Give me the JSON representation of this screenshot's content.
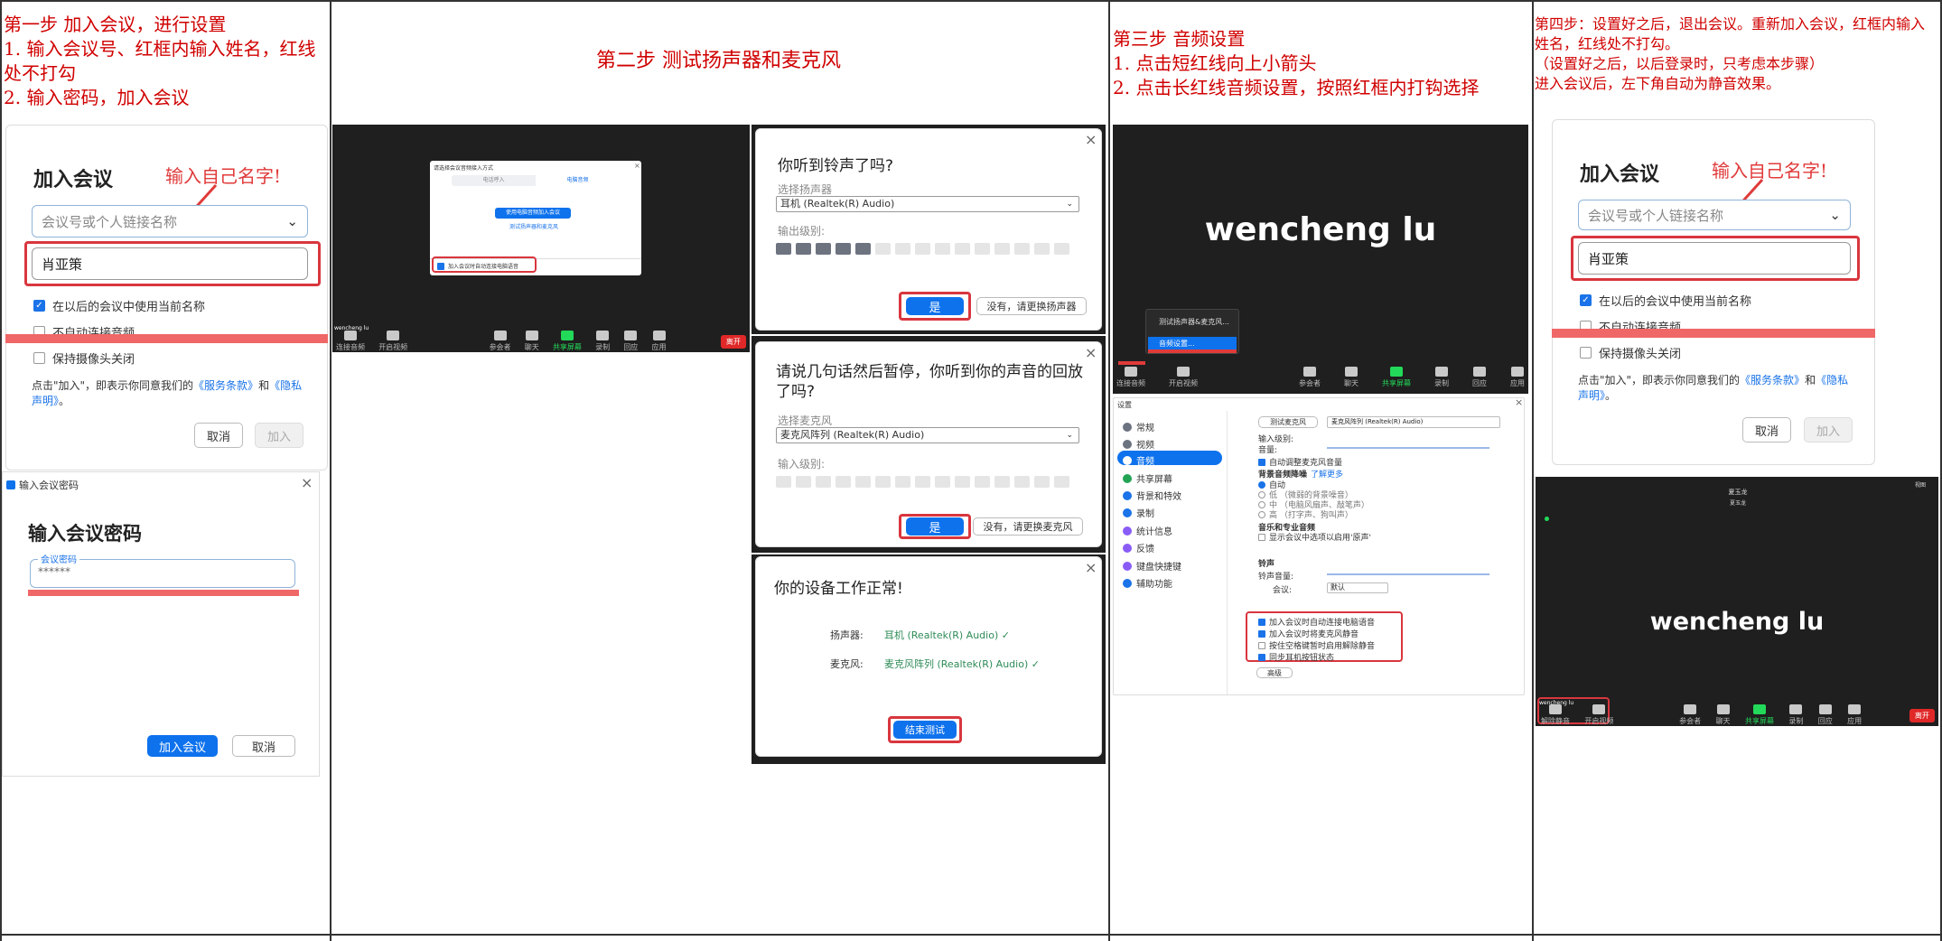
{
  "step1": {
    "title": "第一步  加入会议，进行设置",
    "line1": "1. 输入会议号、红框内输入姓名，红线处不打勾",
    "line2": "2. 输入密码，加入会议"
  },
  "step2": {
    "title": "第二步  测试扬声器和麦克风"
  },
  "step3": {
    "title": "第三步  音频设置",
    "line1": "1. 点击短红线向上小箭头",
    "line2": "2. 点击长红线音频设置，按照红框内打钩选择"
  },
  "step4": {
    "line1": "第四步：设置好之后，退出会议。重新加入会议，红框内输入姓名，红线处不打勾。",
    "line2": "（设置好之后，以后登录时，只考虑本步骤）",
    "line3": "进入会议后，左下角自动为静音效果。"
  },
  "join_dialog": {
    "title": "加入会议",
    "annotation": "输入自己名字!",
    "meeting_placeholder": "会议号或个人链接名称",
    "name_value": "肖亚策",
    "opt_remember": "在以后的会议中使用当前名称",
    "opt_no_audio": "不自动连接音频",
    "opt_camera_off": "保持摄像头关闭",
    "terms_prefix": "点击\"加入\"，即表示你同意我们的",
    "terms_link": "《服务条款》",
    "terms_and": "和",
    "privacy_link": "《隐私声明》",
    "terms_suffix": "。",
    "cancel": "取消",
    "join": "加入"
  },
  "password_dialog": {
    "window_title": "输入会议密码",
    "heading": "输入会议密码",
    "field_label": "会议密码",
    "field_value": "******",
    "join": "加入会议",
    "cancel": "取消"
  },
  "audio_popup": {
    "title": "请选择会议音频接入方式",
    "tab_phone": "电话呼入",
    "tab_computer": "电脑音频",
    "join_btn": "使用电脑音频加入会议",
    "test_link": "测试扬声器和麦克风",
    "auto_join": "加入会议时自动连接电脑语音"
  },
  "meeting_toolbar": {
    "user_label": "wencheng lu",
    "items": [
      "连接音频",
      "开启视频",
      "参会者",
      "聊天",
      "共享屏幕",
      "录制",
      "回应",
      "应用"
    ],
    "end": "离开"
  },
  "speaker_test": {
    "question": "你听到铃声了吗?",
    "select_label": "选择扬声器",
    "device": "耳机 (Realtek(R) Audio)",
    "level_label": "输出级别:",
    "level": 0.3,
    "yes": "是",
    "no": "没有，请更换扬声器"
  },
  "mic_test": {
    "question": "请说几句话然后暂停，你听到你的声音的回放了吗?",
    "select_label": "选择麦克风",
    "device": "麦克风阵列 (Realtek(R) Audio)",
    "level_label": "输入级别:",
    "level": 0,
    "yes": "是",
    "no": "没有，请更换麦克风"
  },
  "device_ok": {
    "title": "你的设备工作正常!",
    "speaker_label": "扬声器:",
    "speaker_value": "耳机 (Realtek(R) Audio) ✓",
    "mic_label": "麦克风:",
    "mic_value": "麦克风阵列 (Realtek(R) Audio) ✓",
    "finish": "结束测试"
  },
  "step3_meeting": {
    "name": "wencheng lu",
    "menu_item1": "测试扬声器&麦克风...",
    "menu_item2": "音频设置...",
    "toolbar": [
      "连接音频",
      "开启视频",
      "参会者",
      "聊天",
      "共享屏幕",
      "录制",
      "回应",
      "应用"
    ]
  },
  "settings": {
    "window_title": "设置",
    "nav": [
      "常规",
      "视频",
      "音频",
      "共享屏幕",
      "背景和特效",
      "录制",
      "统计信息",
      "反馈",
      "键盘快捷键",
      "辅助功能"
    ],
    "active_nav": "音频",
    "test_mic": "测试麦克风",
    "mic_device": "麦克风阵列 (Realtek(R) Audio)",
    "input_level": "输入级别:",
    "volume": "音量:",
    "auto_adjust": "自动调整麦克风音量",
    "noise_title": "背景音频降噪",
    "learn_more": "了解更多",
    "noise_auto": "自动",
    "noise_low": "低  （微弱的背景噪音）",
    "noise_mid": "中  （电脑风扇声、敲笔声）",
    "noise_high": "高  （打字声、狗叫声）",
    "music_title": "音乐和专业音频",
    "music_opt": "显示会议中选项以启用'原声'",
    "ring_title": "铃声",
    "ring_volume": "铃声音量:",
    "meeting_label": "会议:",
    "meeting_value": "默认",
    "opt_auto_audio": "加入会议时自动连接电脑语音",
    "opt_mute_mic": "加入会议时将麦克风静音",
    "opt_space": "按住空格键暂时启用解除静音",
    "opt_sync": "同步耳机按钮状态",
    "advanced": "高级"
  },
  "step4_meeting": {
    "top_name": "夏玉龙",
    "top_sub": "夏玉龙",
    "corner": "视图",
    "name": "wencheng lu",
    "user_label": "wencheng lu",
    "toolbar": [
      "解除静音",
      "开启视频",
      "参会者",
      "聊天",
      "共享屏幕",
      "录制",
      "回应",
      "应用"
    ],
    "end": "离开"
  }
}
